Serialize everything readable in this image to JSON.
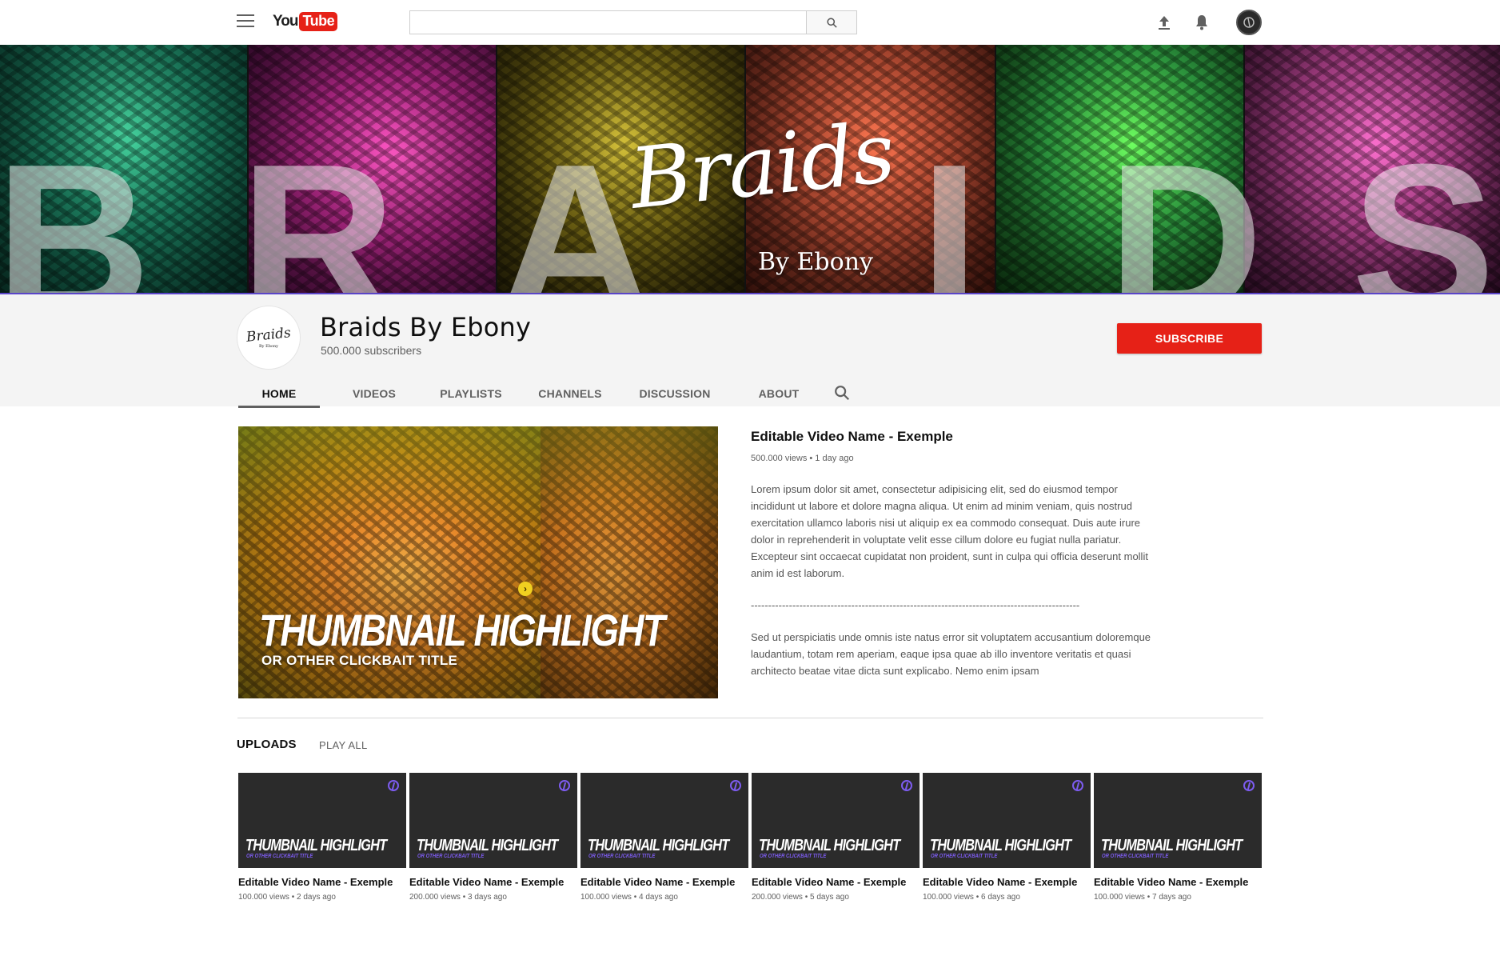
{
  "topbar": {
    "logo_you": "You",
    "logo_tube": "Tube",
    "search_placeholder": "",
    "icons": [
      "menu-icon",
      "search-icon",
      "upload-icon",
      "bell-icon",
      "avatar"
    ]
  },
  "banner": {
    "letters": [
      "B",
      "R",
      "A",
      "I",
      "D",
      "S"
    ],
    "script_title": "Braids",
    "subtitle": "By Ebony",
    "panel_colors": [
      "#2aa37a",
      "#d23aa0",
      "#8a7a18",
      "#d0563a",
      "#36b84c",
      "#c64a9e"
    ]
  },
  "channel": {
    "avatar_script": "Braids",
    "avatar_sub": "By Ebony",
    "name": "Braids By Ebony",
    "subscribers": "500.000 subscribers",
    "subscribe_label": "SUBSCRIBE",
    "tabs": [
      {
        "label": "HOME",
        "active": true
      },
      {
        "label": "VIDEOS",
        "active": false
      },
      {
        "label": "PLAYLISTS",
        "active": false
      },
      {
        "label": "CHANNELS",
        "active": false
      },
      {
        "label": "DISCUSSION",
        "active": false
      },
      {
        "label": "ABOUT",
        "active": false
      }
    ]
  },
  "featured": {
    "headline": "THUMBNAIL HIGHLIGHT",
    "subheadline": "OR OTHER CLICKBAIT TITLE",
    "title": "Editable Video Name - Exemple",
    "meta": "500.000 views • 1 day ago",
    "description": "Lorem ipsum dolor sit amet, consectetur adipisicing elit, sed do eiusmod tempor incididunt ut labore et dolore magna aliqua. Ut enim ad minim veniam, quis nostrud exercitation ullamco laboris nisi ut aliquip ex ea commodo consequat. Duis aute irure dolor in reprehenderit in voluptate velit esse cillum dolore eu fugiat nulla pariatur. Excepteur sint occaecat cupidatat non proident, sunt in culpa qui officia deserunt mollit anim id est laborum.",
    "divider": "-----------------------------------------------------------------------------------------------",
    "description2": "Sed ut perspiciatis unde omnis iste natus error sit voluptatem accusantium doloremque laudantium, totam rem aperiam, eaque ipsa quae ab illo inventore veritatis et quasi architecto beatae vitae dicta sunt explicabo. Nemo enim ipsam"
  },
  "uploads": {
    "label": "UPLOADS",
    "play_all": "PLAY ALL",
    "accent": "#7d5cf0",
    "items": [
      {
        "headline": "THUMBNAIL HIGHLIGHT",
        "sub": "OR OTHER CLICKBAIT TITLE",
        "title": "Editable Video Name - Exemple",
        "meta": "100.000 views • 2 days ago"
      },
      {
        "headline": "THUMBNAIL HIGHLIGHT",
        "sub": "OR OTHER CLICKBAIT TITLE",
        "title": "Editable Video Name - Exemple",
        "meta": "200.000 views • 3 days ago"
      },
      {
        "headline": "THUMBNAIL HIGHLIGHT",
        "sub": "OR OTHER CLICKBAIT TITLE",
        "title": "Editable Video Name - Exemple",
        "meta": "100.000 views • 4 days ago"
      },
      {
        "headline": "THUMBNAIL HIGHLIGHT",
        "sub": "OR OTHER CLICKBAIT TITLE",
        "title": "Editable Video Name - Exemple",
        "meta": "200.000 views • 5 days ago"
      },
      {
        "headline": "THUMBNAIL HIGHLIGHT",
        "sub": "OR OTHER CLICKBAIT TITLE",
        "title": "Editable Video Name - Exemple",
        "meta": "100.000 views • 6 days ago"
      },
      {
        "headline": "THUMBNAIL HIGHLIGHT",
        "sub": "OR OTHER CLICKBAIT TITLE",
        "title": "Editable Video Name - Exemple",
        "meta": "100.000 views • 7 days ago"
      }
    ]
  }
}
